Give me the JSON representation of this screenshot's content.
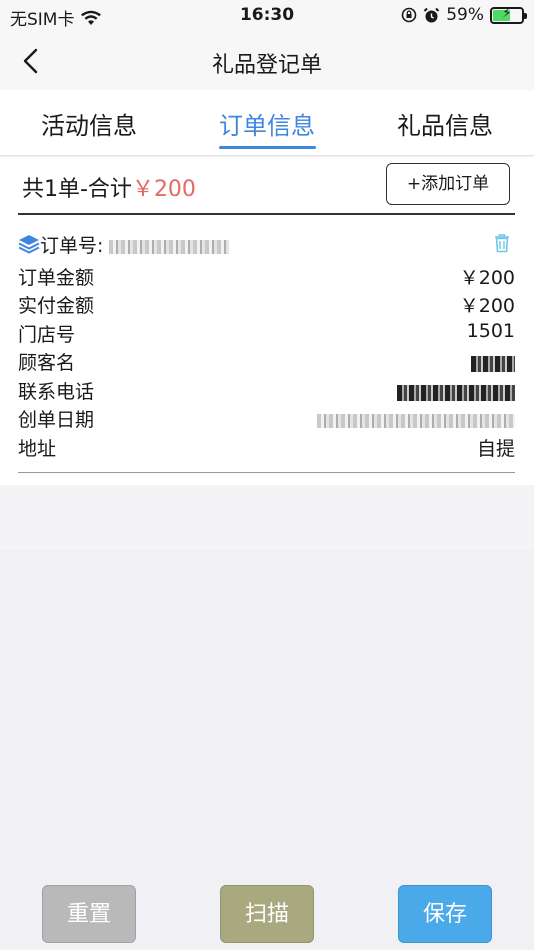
{
  "status_bar": {
    "carrier": "无SIM卡",
    "time": "16:30",
    "battery_percent": "59%",
    "battery_level": 0.59
  },
  "nav": {
    "title": "礼品登记单"
  },
  "tabs": [
    {
      "label": "活动信息",
      "active": false
    },
    {
      "label": "订单信息",
      "active": true
    },
    {
      "label": "礼品信息",
      "active": false
    }
  ],
  "summary": {
    "prefix": "共1单-合计",
    "amount": "￥200",
    "add_button": "+添加订单"
  },
  "order": {
    "number_label": "订单号:",
    "fields": [
      {
        "label": "订单金额",
        "value": "￥200"
      },
      {
        "label": "实付金额",
        "value": "￥200"
      },
      {
        "label": "门店号",
        "value": "1501"
      },
      {
        "label": "顾客名",
        "value": ""
      },
      {
        "label": "联系电话",
        "value": ""
      },
      {
        "label": "创单日期",
        "value": ""
      },
      {
        "label": "地址",
        "value": "自提"
      }
    ]
  },
  "buttons": {
    "reset": "重置",
    "scan": "扫描",
    "save": "保存"
  },
  "colors": {
    "accent": "#3f86e0",
    "amount": "#e26b63",
    "reset_bg": "#b9b9b9",
    "scan_bg": "#a9a97f",
    "save_bg": "#4aa9e8"
  }
}
